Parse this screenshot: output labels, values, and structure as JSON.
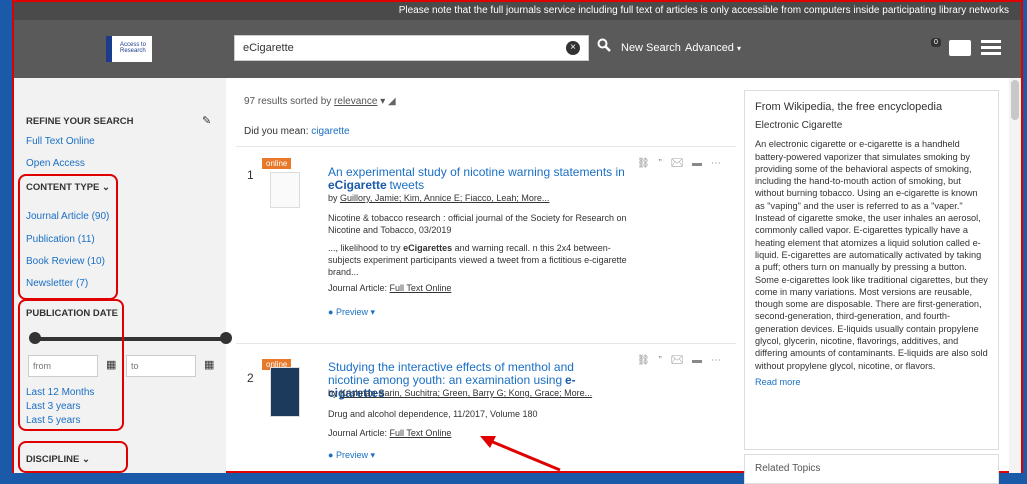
{
  "notice": "Please note that the full journals service including full text of articles is only accessible from computers inside participating library networks",
  "logo": {
    "line1": "Access to",
    "line2": "Research"
  },
  "search": {
    "value": "eCigarette",
    "clear_icon": "×",
    "new_search": "New Search",
    "advanced": "Advanced"
  },
  "folder_count": "0",
  "sidebar": {
    "refine_title": "REFINE YOUR SEARCH",
    "full_text": "Full Text Online",
    "open_access": "Open Access",
    "content_type_title": "CONTENT TYPE",
    "content_types": [
      {
        "label": "Journal Article (90)"
      },
      {
        "label": "Publication (11)"
      },
      {
        "label": "Book Review (10)"
      },
      {
        "label": "Newsletter (7)"
      }
    ],
    "pubdate_title": "PUBLICATION DATE",
    "from_placeholder": "from",
    "to_placeholder": "to",
    "date_links": [
      "Last 12 Months",
      "Last 3 years",
      "Last 5 years"
    ],
    "discipline_title": "DISCIPLINE"
  },
  "results_header": {
    "count_text": "97 results sorted by",
    "sort": "relevance"
  },
  "did_you_mean": {
    "label": "Did you mean:",
    "suggestion": "cigarette"
  },
  "results": [
    {
      "number": "1",
      "tag": "online",
      "title_prefix": "An experimental study of nicotine warning statements in",
      "title_bold": "eCigarette",
      "title_suffix": "tweets",
      "authors": "Guillory, Jamie; Kim, Annice E; Fiacco, Leah; More...",
      "source": "Nicotine & tobacco research : official journal of the Society for Research on Nicotine and Tobacco, 03/2019",
      "snippet_1": "..., likelihood to try",
      "snippet_bold": "eCigarettes",
      "snippet_2": "and warning recall. n this 2x4 between-subjects experiment participants viewed a tweet from a fictitious e-cigarette brand...",
      "type_label": "Journal Article:",
      "full_text": "Full Text Online",
      "preview": "Preview"
    },
    {
      "number": "2",
      "tag": "online",
      "title_prefix": "Studying the interactive effects of menthol and nicotine among youth: an examination using",
      "title_bold": "e-cigarettes",
      "authors": "Krishnan-Sarin, Suchitra; Green, Barry G; Kong, Grace; More...",
      "source": "Drug and alcohol dependence, 11/2017, Volume 180",
      "type_label": "Journal Article:",
      "full_text": "Full Text Online",
      "preview": "Preview"
    }
  ],
  "wiki": {
    "source": "From Wikipedia, the free encyclopedia",
    "title": "Electronic Cigarette",
    "body": "An electronic cigarette or e-cigarette is a handheld battery-powered vaporizer that simulates smoking by providing some of the behavioral aspects of smoking, including the hand-to-mouth action of smoking, but without burning tobacco. Using an e-cigarette is known as \"vaping\" and the user is referred to as a \"vaper.\" Instead of cigarette smoke, the user inhales an aerosol, commonly called vapor. E-cigarettes typically have a heating element that atomizes a liquid solution called e-liquid. E-cigarettes are automatically activated by taking a puff; others turn on manually by pressing a button. Some e-cigarettes look like traditional cigarettes, but they come in many variations. Most versions are reusable, though some are disposable. There are first-generation, second-generation, third-generation, and fourth-generation devices. E-liquids usually contain propylene glycol, glycerin, nicotine, flavorings, additives, and differing amounts of contaminants. E-liquids are also sold without propylene glycol, nicotine, or flavors.",
    "read_more": "Read more",
    "related": "Related Topics"
  },
  "colors": {
    "accent": "#1a6fc4",
    "annotation": "#e00000",
    "tag": "#e8792a",
    "header": "#5a5a5a"
  }
}
